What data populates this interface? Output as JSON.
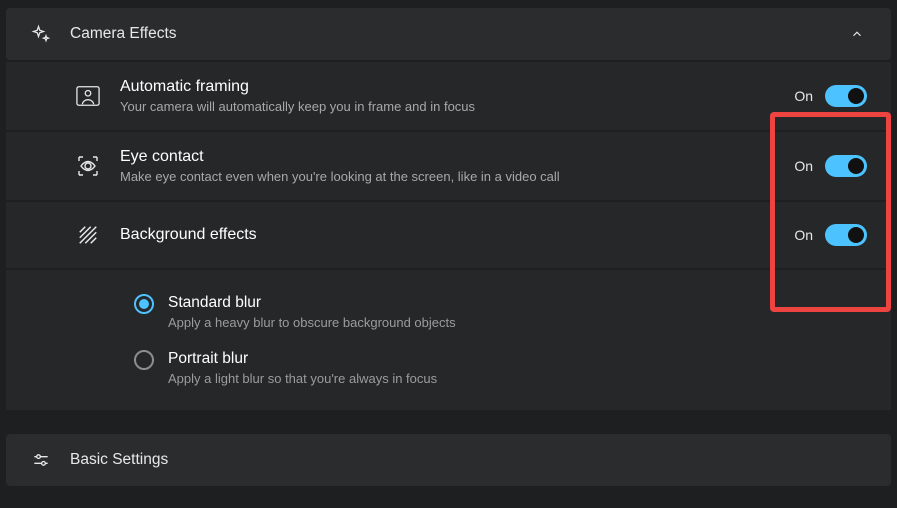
{
  "sections": {
    "camera_effects": {
      "title": "Camera Effects"
    },
    "basic_settings": {
      "title": "Basic Settings"
    }
  },
  "rows": {
    "auto_framing": {
      "title": "Automatic framing",
      "desc": "Your camera will automatically keep you in frame and in focus",
      "status": "On"
    },
    "eye_contact": {
      "title": "Eye contact",
      "desc": "Make eye contact even when you're looking at the screen, like in a video call",
      "status": "On"
    },
    "bg_effects": {
      "title": "Background effects",
      "status": "On"
    }
  },
  "bg_options": {
    "standard": {
      "title": "Standard blur",
      "desc": "Apply a heavy blur to obscure background objects",
      "selected": true
    },
    "portrait": {
      "title": "Portrait blur",
      "desc": "Apply a light blur so that you're always in focus",
      "selected": false
    }
  },
  "colors": {
    "accent": "#4cc2ff",
    "highlight": "#ed4442"
  }
}
